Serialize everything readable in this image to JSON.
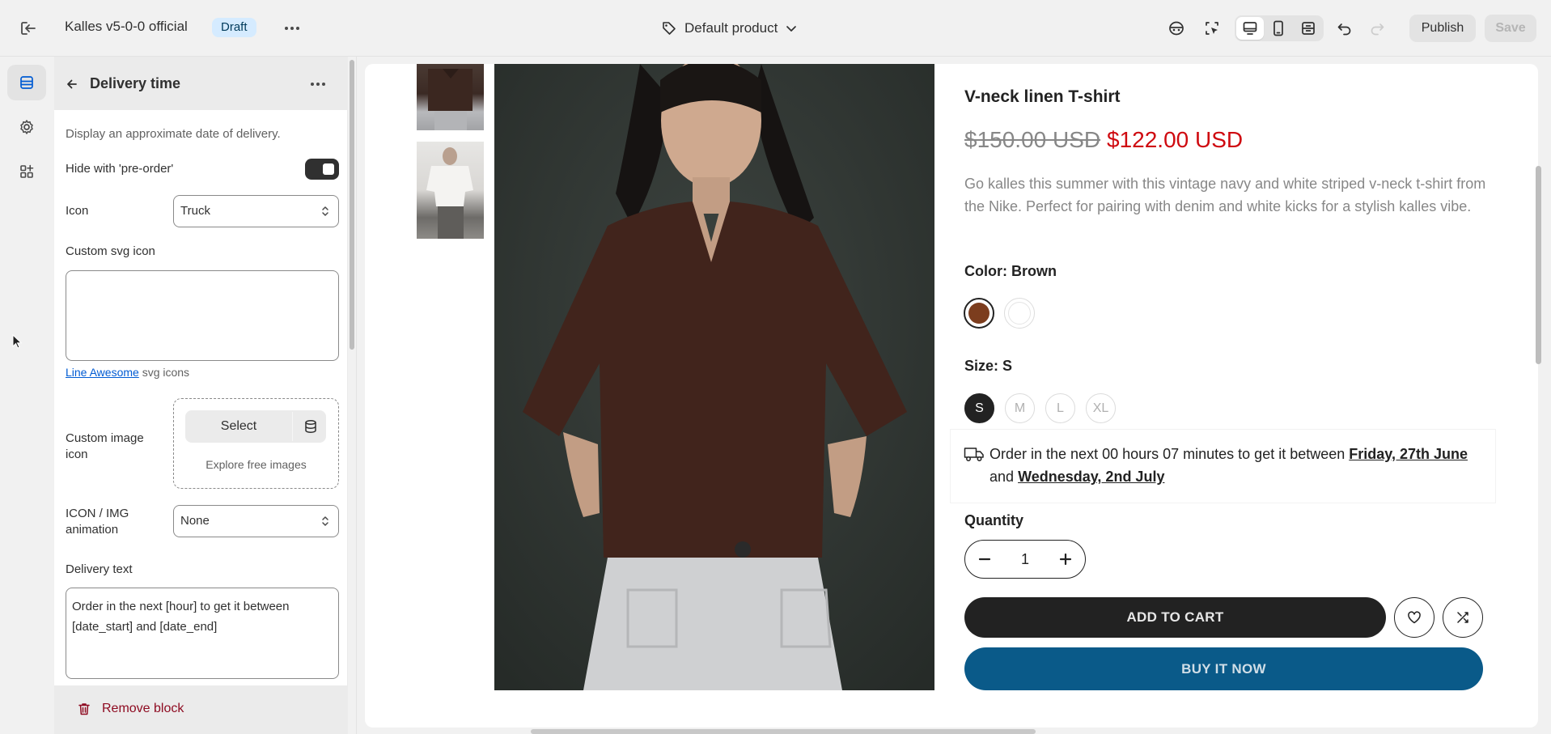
{
  "topbar": {
    "store_name": "Kalles v5-0-0 official",
    "status_badge": "Draft",
    "template_name": "Default product",
    "publish_label": "Publish",
    "save_label": "Save"
  },
  "panel": {
    "title": "Delivery time",
    "description": "Display an approximate date of delivery.",
    "hide_preorder_label": "Hide with 'pre-order'",
    "hide_preorder_on": true,
    "icon_label": "Icon",
    "icon_value": "Truck",
    "custom_svg_label": "Custom svg icon",
    "custom_svg_value": "",
    "helper_link": "Line Awesome",
    "helper_suffix": "svg icons",
    "custom_image_label": "Custom image icon",
    "select_label": "Select",
    "explore_label": "Explore free images",
    "animation_label": "ICON / IMG animation",
    "animation_value": "None",
    "delivery_text_label": "Delivery text",
    "delivery_text_value": "Order in the next [hour] to get it between [date_start] and [date_end]",
    "remove_label": "Remove block"
  },
  "preview": {
    "product_title": "V-neck linen T-shirt",
    "compare_price": "$150.00 USD",
    "price": "$122.00 USD",
    "description": "Go kalles this summer with this vintage navy and white striped v-neck t-shirt from the Nike. Perfect for pairing with denim and white kicks for a stylish kalles vibe.",
    "color_label": "Color: Brown",
    "swatches": [
      "#7c3d1e",
      "#ffffff"
    ],
    "size_label": "Size: S",
    "sizes": [
      "S",
      "M",
      "L",
      "XL"
    ],
    "delivery_prefix": "Order in the next 00 hours 07 minutes to get it between",
    "delivery_start": "Friday, 27th June",
    "delivery_and": "and",
    "delivery_end": "Wednesday, 2nd July",
    "quantity_label": "Quantity",
    "quantity_value": "1",
    "add_to_cart": "ADD TO CART",
    "buy_now": "BUY IT NOW"
  },
  "colors": {
    "accent_dark": "#303030",
    "price_red": "#cf0a10",
    "buy_blue": "#0a5a89",
    "remove_red": "#8e0b21",
    "link_blue": "#005bd3"
  }
}
